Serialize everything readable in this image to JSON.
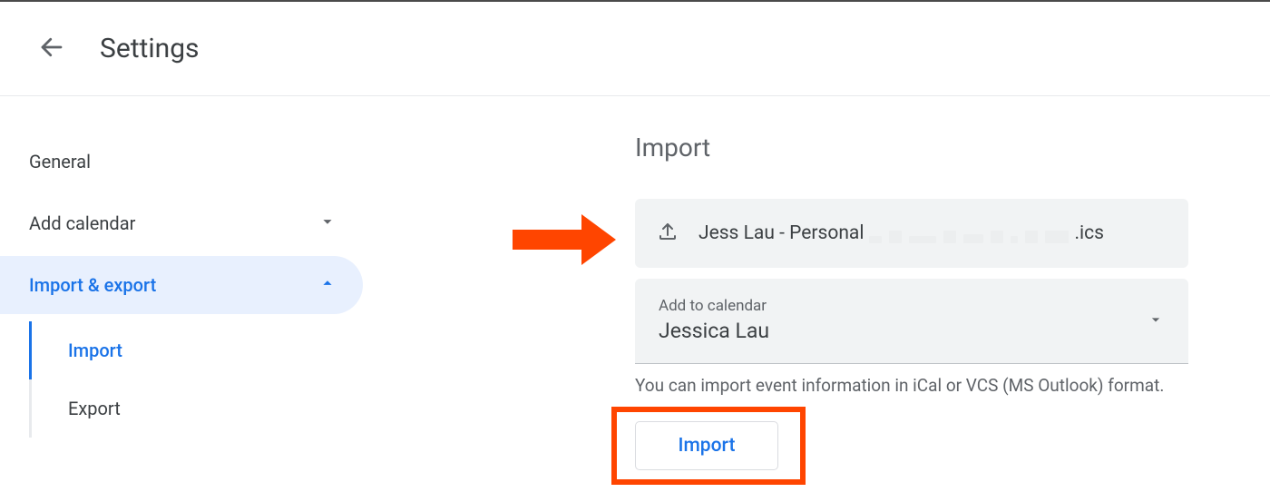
{
  "header": {
    "title": "Settings"
  },
  "sidebar": {
    "general": "General",
    "add_calendar": "Add calendar",
    "import_export": "Import & export",
    "sub_import": "Import",
    "sub_export": "Export"
  },
  "main": {
    "section_title": "Import",
    "file_prefix": "Jess Lau - Personal",
    "file_suffix": ".ics",
    "dropdown_label": "Add to calendar",
    "dropdown_value": "Jessica Lau",
    "helper": "You can import event information in iCal or VCS (MS Outlook) format.",
    "button": "Import"
  },
  "annotation": {
    "arrow_color": "#ff4500",
    "highlight_color": "#ff4500"
  }
}
